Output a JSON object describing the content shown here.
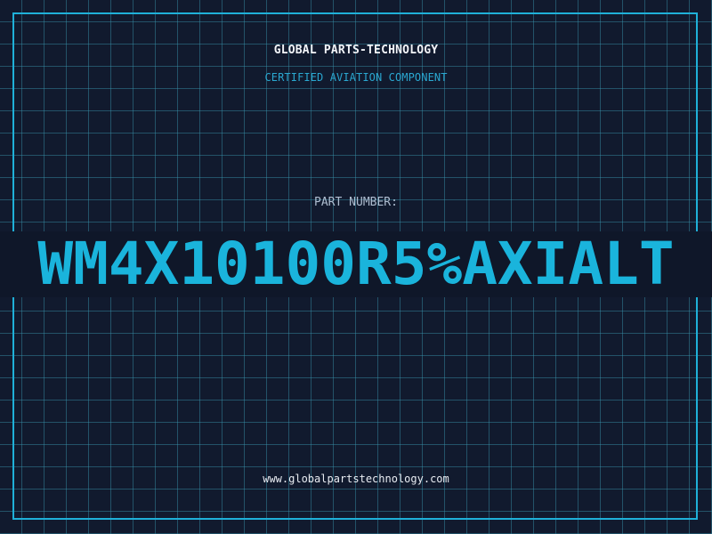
{
  "header": {
    "brand": "GLOBAL PARTS-TECHNOLOGY",
    "subtitle": "CERTIFIED AVIATION COMPONENT"
  },
  "part": {
    "label": "PART NUMBER:",
    "number": "WM4X10100R5%AXIALT"
  },
  "footer": {
    "website": "www.globalpartstechnology.com"
  },
  "colors": {
    "background": "#111a2e",
    "accent": "#1ab4dc",
    "grid": "#3a96af"
  }
}
